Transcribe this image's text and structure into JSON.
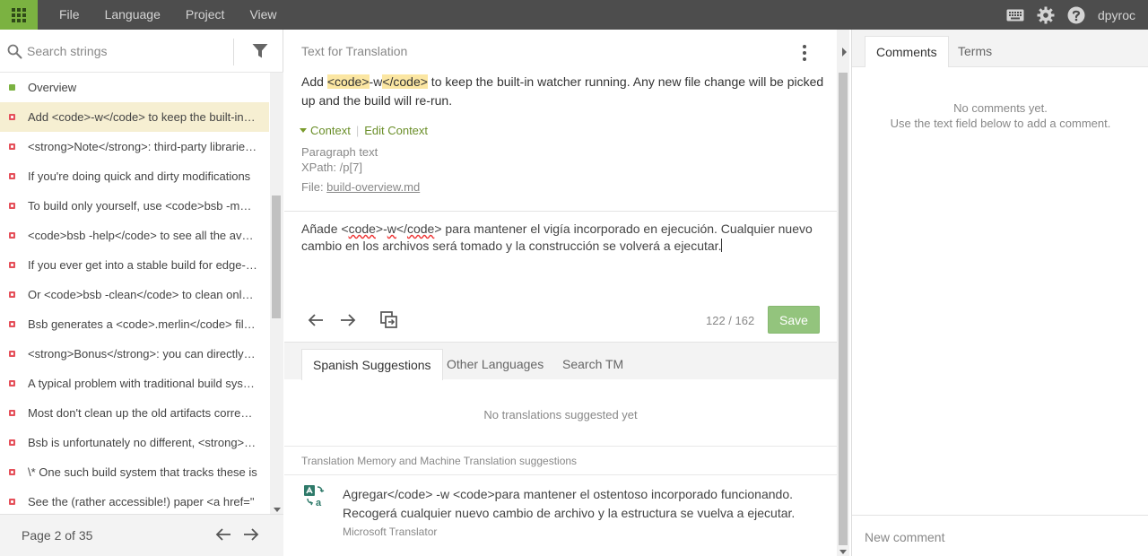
{
  "topbar": {
    "menu": [
      "File",
      "Language",
      "Project",
      "View"
    ],
    "username": "dpyroc",
    "icons": [
      "apps-grid-icon",
      "keyboard-icon",
      "gear-icon",
      "help-icon"
    ],
    "accent_color": "#7bb241"
  },
  "left_panel": {
    "search_placeholder": "Search strings",
    "items": [
      {
        "label": "Overview",
        "status": "green"
      },
      {
        "label": "Add <code>-w</code> to keep the built-in watcher running. Any new file change will be picked up",
        "status": "red",
        "selected": true
      },
      {
        "label": "<strong>Note</strong>: third-party libraries are not rebuilt",
        "status": "red"
      },
      {
        "label": "If you're doing quick and dirty modifications",
        "status": "red"
      },
      {
        "label": "To build only yourself, use <code>bsb -make-world</code>",
        "status": "red"
      },
      {
        "label": "<code>bsb -help</code> to see all the available options",
        "status": "red"
      },
      {
        "label": "If you ever get into a stable build for edge-cases",
        "status": "red"
      },
      {
        "label": "Or <code>bsb -clean</code> to clean only your project",
        "status": "red"
      },
      {
        "label": "Bsb generates a <code>.merlin</code> file, used by editors",
        "status": "red"
      },
      {
        "label": "<strong>Bonus</strong>: you can directly run the build",
        "status": "red"
      },
      {
        "label": "A typical problem with traditional build systems",
        "status": "red"
      },
      {
        "label": "Most don't clean up the old artifacts correctly",
        "status": "red"
      },
      {
        "label": "Bsb is unfortunately no different, <strong>but</strong>",
        "status": "red"
      },
      {
        "label": "\\* One such build system that tracks these is",
        "status": "red"
      },
      {
        "label": "See the (rather accessible!) paper <a href=\"",
        "status": "red"
      }
    ],
    "pager": {
      "label": "Page 2 of 35"
    }
  },
  "middle_panel": {
    "header": "Text for Translation",
    "source": {
      "part1": "Add ",
      "code1": "<code>",
      "part2": "-w",
      "code2": "</code>",
      "part3": " to keep the built-in watcher running. Any new file change will be picked up and the build will re-run."
    },
    "context": {
      "toggle_label": "Context",
      "edit_label": "Edit Context",
      "paragraph": "Paragraph text",
      "xpath": "XPath: /p[7]",
      "file_prefix": "File: ",
      "file_name": "build-overview.md"
    },
    "translation": {
      "part1": "Añade <",
      "code1": "code",
      "part2": ">-",
      "w": "w",
      "part3": "</",
      "code2": "code",
      "part4": "> para mantener el vigía incorporado en ejecución. Cualquier nuevo cambio en los archivos será tomado y la construcción se volverá a ejecutar."
    },
    "counter": "122 / 162",
    "save_label": "Save",
    "tabs": [
      "Spanish Suggestions",
      "Other Languages",
      "Search TM"
    ],
    "no_suggestions": "No translations suggested yet",
    "tm_header": "Translation Memory and Machine Translation suggestions",
    "mt_suggestion": {
      "text": "Agregar</code> -w <code>para mantener el ostentoso incorporado funcionando. Recogerá cualquier nuevo cambio de archivo y la estructura se vuelva a ejecutar.",
      "source": "Microsoft Translator"
    }
  },
  "right_panel": {
    "tabs": [
      "Comments",
      "Terms"
    ],
    "no_comments_line1": "No comments yet.",
    "no_comments_line2": "Use the text field below to add a comment.",
    "comment_placeholder": "New comment"
  }
}
